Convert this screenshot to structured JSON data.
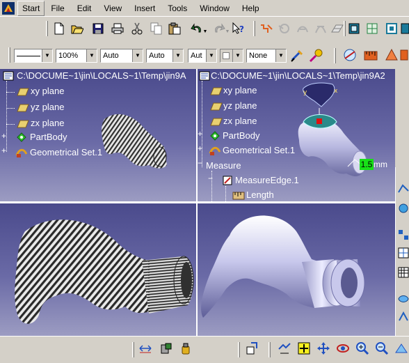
{
  "menu": [
    "Start",
    "File",
    "Edit",
    "View",
    "Insert",
    "Tools",
    "Window",
    "Help"
  ],
  "toolbar2": {
    "line_combo": "",
    "zoom_combo": "100%",
    "auto1": "Auto",
    "auto2": "Auto",
    "auto3": "Aut",
    "layer_combo": "",
    "none_combo": "None"
  },
  "tree_left": {
    "root": "C:\\DOCUME~1\\jin\\LOCALS~1\\Temp\\jin9A",
    "items": [
      "xy plane",
      "yz plane",
      "zx plane",
      "PartBody",
      "Geometrical Set.1"
    ]
  },
  "tree_right": {
    "root": "C:\\DOCUME~1\\jin\\LOCALS~1\\Temp\\jin9A2",
    "items": [
      "xy plane",
      "yz plane",
      "zx plane",
      "PartBody",
      "Geometrical Set.1",
      "Measure",
      "MeasureEdge.1",
      "Length"
    ]
  },
  "measure_value": "1.5",
  "measure_unit": "mm",
  "colors": {
    "viewport_top": "#4a4a8c",
    "viewport_bottom": "#9c9cc2",
    "measure_tag": "#18e018",
    "ui_gray": "#d4d0c8"
  }
}
